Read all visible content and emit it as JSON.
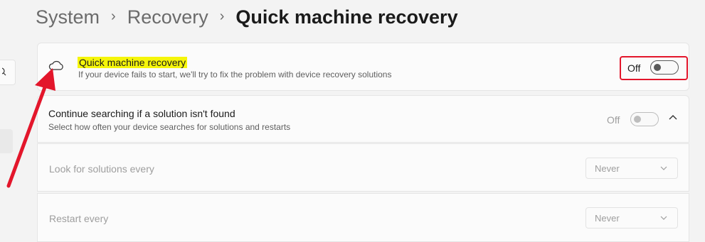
{
  "breadcrumb": {
    "items": [
      "System",
      "Recovery"
    ],
    "current": "Quick machine recovery"
  },
  "qmr": {
    "title": "Quick machine recovery",
    "description": "If your device fails to start, we'll try to fix the problem with device recovery solutions",
    "toggle_state": "Off",
    "icon": "cloud-icon"
  },
  "continue_search": {
    "title": "Continue searching if a solution isn't found",
    "description": "Select how often your device searches for solutions and restarts",
    "toggle_state": "Off"
  },
  "look_for_solutions": {
    "label": "Look for solutions every",
    "value": "Never"
  },
  "restart_every": {
    "label": "Restart every",
    "value": "Never"
  },
  "colors": {
    "annotation_red": "#e3162b",
    "text_highlight": "#f5f50a"
  }
}
